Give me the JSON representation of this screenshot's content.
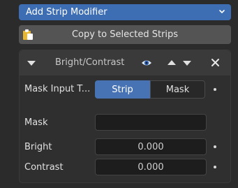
{
  "add_strip_modifier": {
    "label": "Add Strip Modifier"
  },
  "copy_button": {
    "label": "Copy to Selected Strips"
  },
  "modifier": {
    "title": "Bright/Contrast",
    "mask_input_type": {
      "label": "Mask Input T...",
      "options": [
        "Strip",
        "Mask"
      ],
      "selected": "Strip"
    },
    "mask": {
      "label": "Mask",
      "value": ""
    },
    "bright": {
      "label": "Bright",
      "value": "0.000"
    },
    "contrast": {
      "label": "Contrast",
      "value": "0.000"
    }
  },
  "colors": {
    "accent": "#4772b3",
    "panel_bg": "#2b2b2b",
    "header_bg": "#3a3a3a",
    "field_bg": "#1d1d1d",
    "eye_icon": "#6e9ad8"
  },
  "icons": [
    "chevron-down-icon",
    "paste-icon",
    "collapse-arrow-icon",
    "eye-icon",
    "move-up-icon",
    "move-down-icon",
    "close-icon"
  ]
}
